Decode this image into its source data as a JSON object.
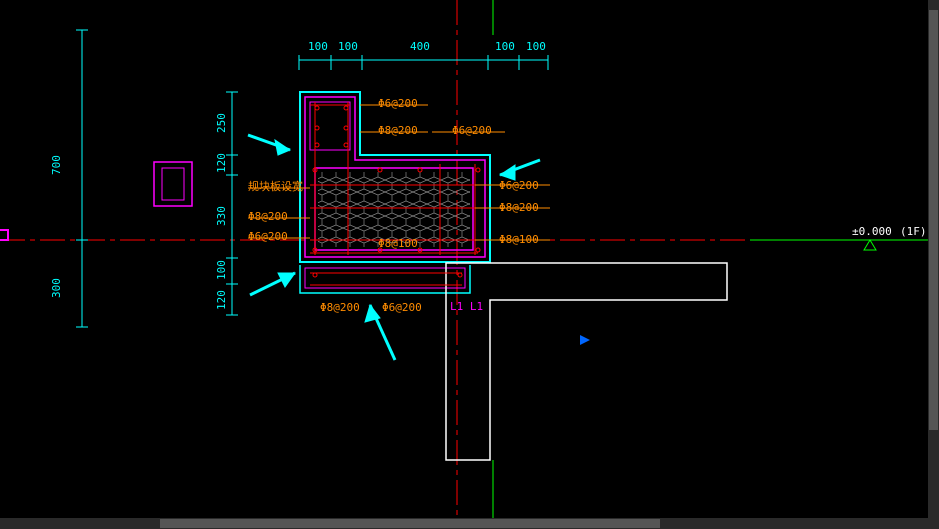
{
  "dimensions_top": {
    "d1": "100",
    "d2": "100",
    "d3": "400",
    "d4": "100",
    "d5": "100"
  },
  "dimensions_left_outer": {
    "d1": "700",
    "d2": "300"
  },
  "dimensions_left_inner": {
    "d1": "250",
    "d2": "120",
    "d3": "330",
    "d4": "100",
    "d5": "120"
  },
  "rebar_labels": {
    "r1": "Φ6@200",
    "r2": "Φ8@200",
    "r3": "Φ6@200",
    "r4": "规块板设宽",
    "r5": "Φ8@200",
    "r6": "Φ6@200",
    "r7": "Φ6@200",
    "r8": "Φ8@200",
    "r9": "Φ8@100",
    "r10": "Φ8@100",
    "r11": "Φ8@200",
    "r12": "Φ6@200"
  },
  "level": {
    "elevation": "±0.000",
    "floor": "(1F)"
  },
  "wall_label": "L1 L1"
}
